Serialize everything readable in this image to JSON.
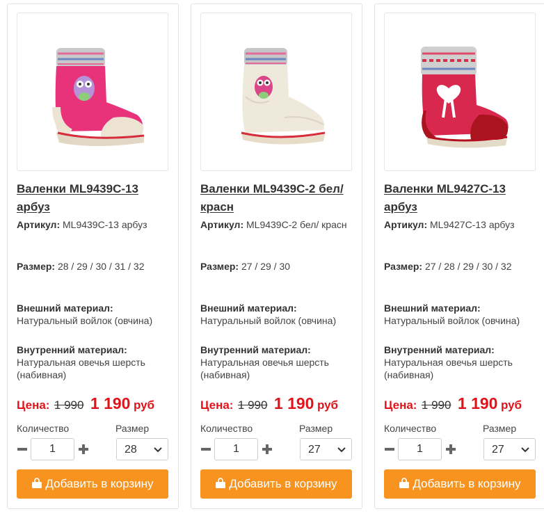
{
  "labels": {
    "article": "Артикул:",
    "size": "Размер:",
    "outer_material": "Внешний материал:",
    "inner_material": "Внутренний материал:",
    "price": "Цена:",
    "quantity": "Количество",
    "size_select": "Размер",
    "add_to_cart": "Добавить в корзину",
    "currency": "руб"
  },
  "colors": {
    "accent": "#f7931e",
    "price_red": "#e1131a"
  },
  "products": [
    {
      "title": "Валенки ML9439C-13 арбуз",
      "article": "ML9439C-13 арбуз",
      "sizes": "28 / 29 / 30 / 31 / 32",
      "outer_material": "Натуральный войлок (овчина)",
      "inner_material": "Натуральная овечья шерсть (набивная)",
      "old_price": "1 990",
      "new_price": "1 190",
      "quantity": "1",
      "selected_size": "28",
      "image": "pink-felt-boot-owl"
    },
    {
      "title": "Валенки ML9439C-2 бел/красн",
      "article": "ML9439C-2 бел/ красн",
      "sizes": "27 / 29 / 30",
      "outer_material": "Натуральный войлок (овчина)",
      "inner_material": "Натуральная овечья шерсть (набивная)",
      "old_price": "1 990",
      "new_price": "1 190",
      "quantity": "1",
      "selected_size": "27",
      "image": "white-felt-boot-owl"
    },
    {
      "title": "Валенки ML9427C-13 арбуз",
      "article": "ML9427C-13 арбуз",
      "sizes": "27 / 28 / 29 / 30 / 32",
      "outer_material": "Натуральный войлок (овчина)",
      "inner_material": "Натуральная овечья шерсть (набивная)",
      "old_price": "1 990",
      "new_price": "1 190",
      "quantity": "1",
      "selected_size": "27",
      "image": "red-felt-boot-heart"
    }
  ]
}
